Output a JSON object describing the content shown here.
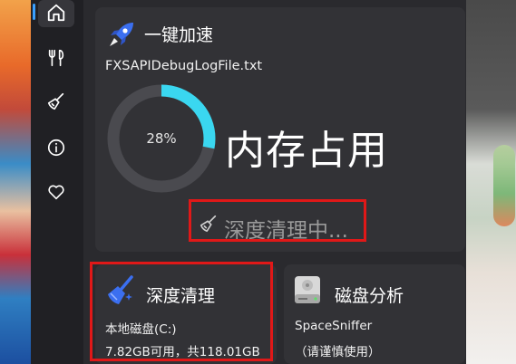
{
  "boost_panel": {
    "title": "一键加速",
    "file_name": "FXSAPIDebugLogFile.txt",
    "memory_percent": 0.28,
    "memory_percent_label": "28%",
    "memory_label": "内存占用",
    "status_text": "深度清理中..."
  },
  "deep_clean_card": {
    "title": "深度清理",
    "drive_label": "本地磁盘(C:)",
    "capacity_text": "7.82GB可用，共118.01GB"
  },
  "disk_analysis_card": {
    "title": "磁盘分析",
    "tool_name": "SpaceSniffer",
    "note": "（请谨慎使用）"
  },
  "colors": {
    "accent": "#3ad7f0",
    "ring_track": "#4a4a4f",
    "highlight_box": "#e01818",
    "panel_bg": "#323236"
  }
}
